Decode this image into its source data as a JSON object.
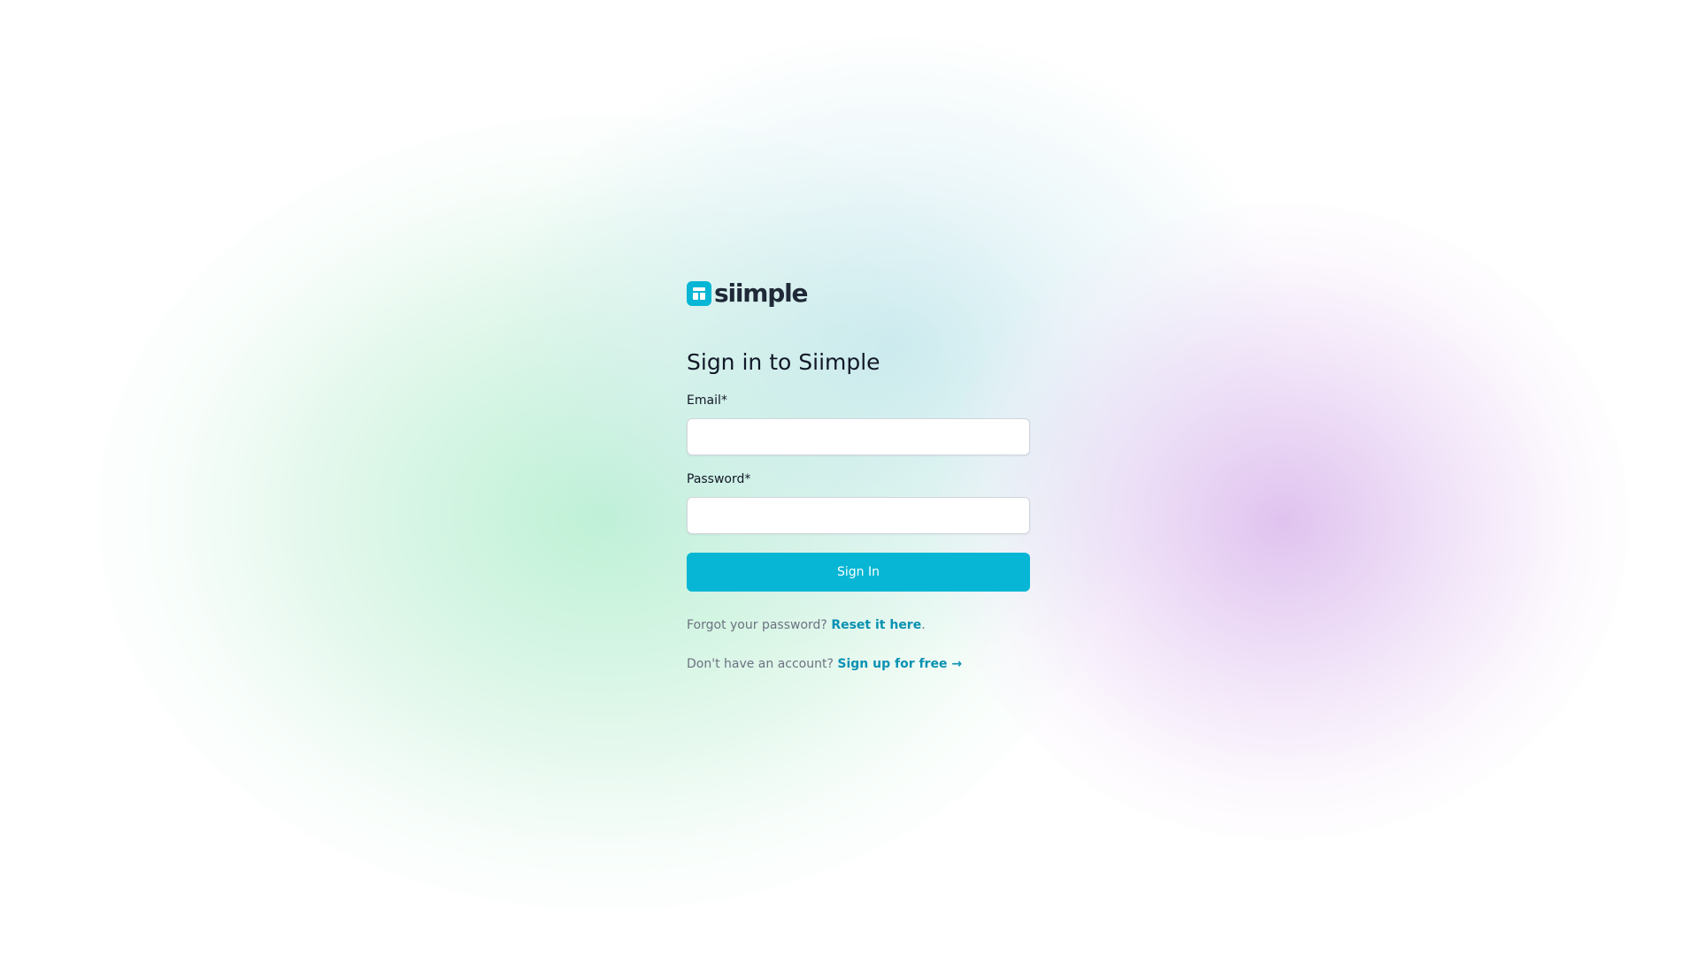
{
  "logo": {
    "text": "siimple",
    "icon": "layout-grid-icon",
    "color": "#06b6d4"
  },
  "page": {
    "title": "Sign in to Siimple"
  },
  "form": {
    "email": {
      "label": "Email*",
      "value": "",
      "placeholder": ""
    },
    "password": {
      "label": "Password*",
      "value": "",
      "placeholder": ""
    },
    "submit_label": "Sign In"
  },
  "links": {
    "forgot_text": "Forgot your password?",
    "forgot_link": "Reset it here",
    "forgot_suffix": ".",
    "signup_text": "Don't have an account?",
    "signup_link": "Sign up for free →"
  },
  "colors": {
    "accent": "#06b6d4",
    "link": "#0891b2",
    "muted_text": "#6b7280"
  }
}
